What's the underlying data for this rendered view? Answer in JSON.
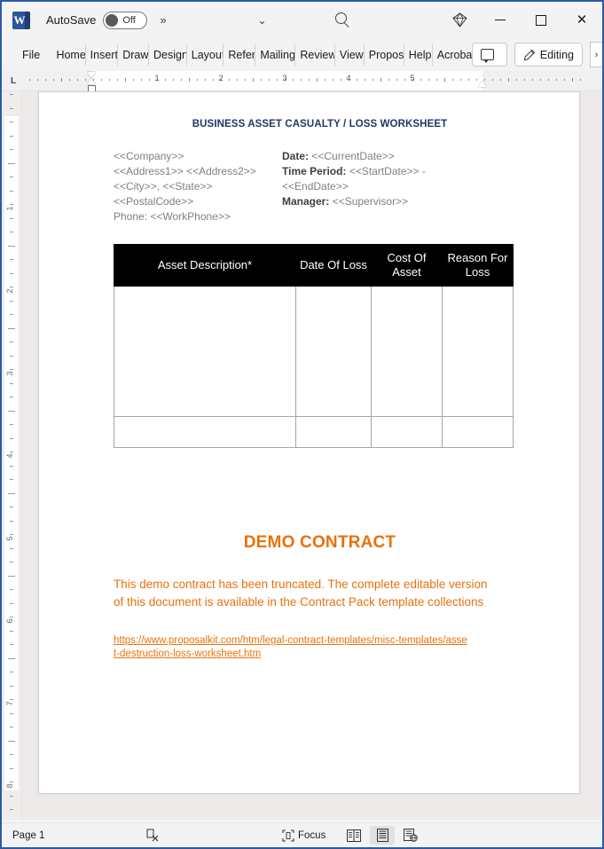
{
  "window": {
    "app_icon": "word-logo-icon",
    "autosave_label": "AutoSave",
    "autosave_state": "Off",
    "more_commands": "»",
    "customize_caret": "⌄",
    "search_icon": "search-icon",
    "copilot_icon": "diamond-icon",
    "minimize": "minimize-icon",
    "maximize": "maximize-icon",
    "close": "close-icon"
  },
  "ribbon": {
    "tabs": [
      {
        "label": "File"
      },
      {
        "label": "Home"
      },
      {
        "label": "Insert"
      },
      {
        "label": "Draw"
      },
      {
        "label": "Design"
      },
      {
        "label": "Layout"
      },
      {
        "label": "Refer"
      },
      {
        "label": "Mailings"
      },
      {
        "label": "Review"
      },
      {
        "label": "View"
      },
      {
        "label": "Proposal"
      },
      {
        "label": "Help"
      },
      {
        "label": "Acrobat"
      }
    ],
    "comments_label": "",
    "editing_label": "Editing",
    "expand_caret": "›"
  },
  "ruler": {
    "tab_stop_marker": "L",
    "h_numbers": [
      "1",
      "2",
      "3",
      "4",
      "5"
    ],
    "v_numbers": [
      "1",
      "2",
      "3",
      "4",
      "5",
      "6",
      "7",
      "8"
    ]
  },
  "document": {
    "title": "BUSINESS ASSET CASUALTY / LOSS WORKSHEET",
    "fields_left": [
      "<<Company>>",
      "<<Address1>> <<Address2>>",
      "<<City>>, <<State>>",
      "<<PostalCode>>",
      "Phone: <<WorkPhone>>"
    ],
    "fields_right": [
      {
        "label": "Date:",
        "value": "<<CurrentDate>>"
      },
      {
        "label": "Time Period:",
        "value": "<<StartDate>> -"
      },
      {
        "label": "",
        "value": "<<EndDate>>"
      },
      {
        "label": "Manager:",
        "value": "<<Supervisor>>"
      }
    ],
    "table": {
      "headers": [
        "Asset Description*",
        "Date Of Loss",
        "Cost Of Asset",
        "Reason For Loss"
      ],
      "rows": [
        [
          "",
          "",
          "",
          ""
        ],
        [
          "",
          "",
          "",
          ""
        ]
      ]
    },
    "demo_title": "DEMO CONTRACT",
    "demo_body": "This demo contract has been truncated. The complete editable version of this document is available in the Contract Pack template collections",
    "demo_link": "https://www.proposalkit.com/htm/legal-contract-templates/misc-templates/asset-destruction-loss-worksheet.htm",
    "accent_color": "#e8720c",
    "title_color": "#1f3864"
  },
  "statusbar": {
    "page_label": "Page 1",
    "proofing_icon": "proofing-errors-icon",
    "focus_label": "Focus",
    "view_read": "read-mode-icon",
    "view_print": "print-layout-icon",
    "view_web": "web-layout-icon"
  }
}
